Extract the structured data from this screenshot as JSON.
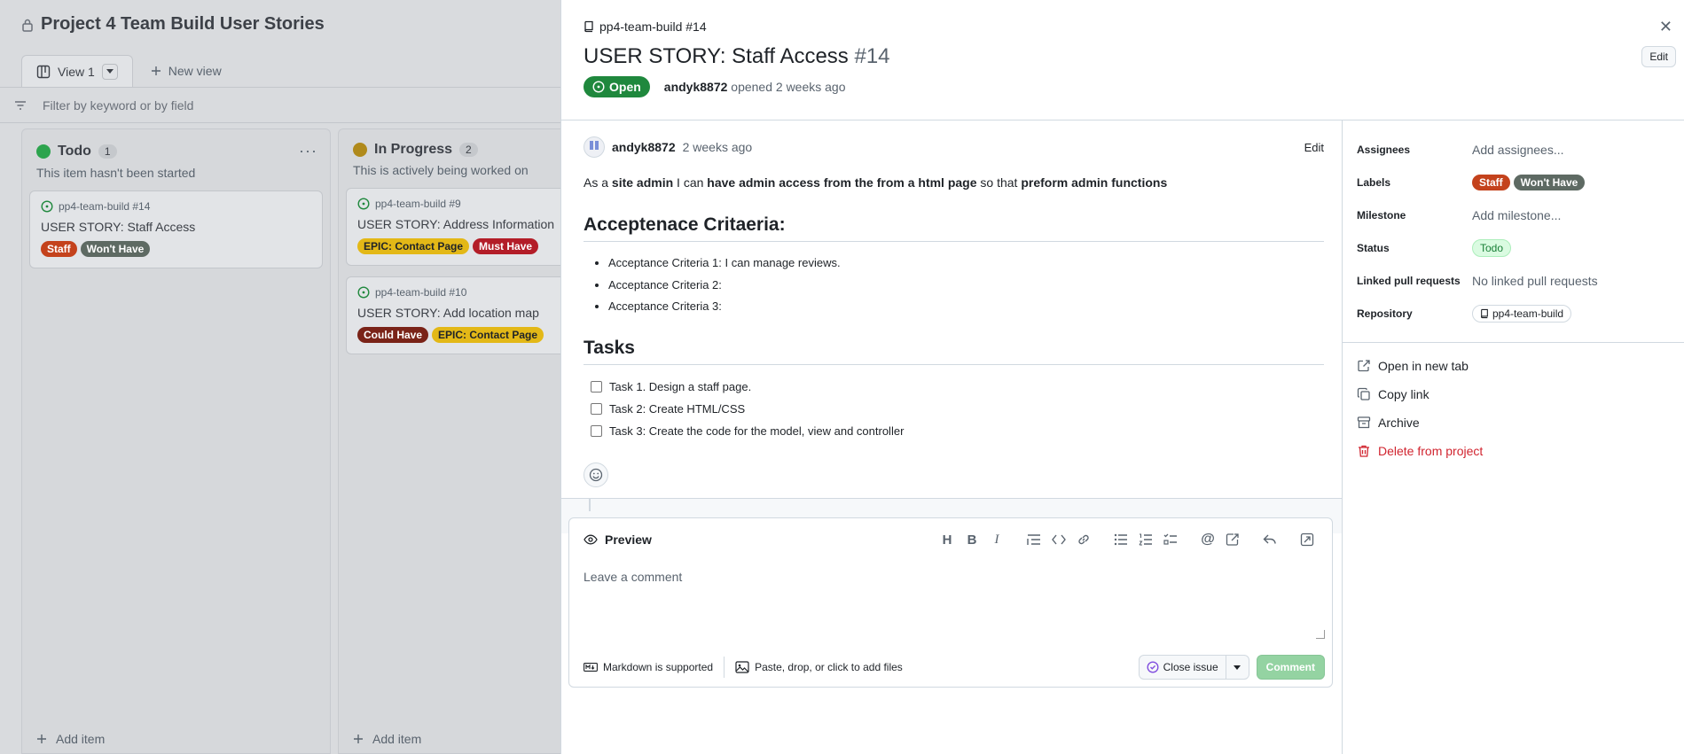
{
  "board": {
    "title": "Project 4 Team Build User Stories",
    "view_tab": "View 1",
    "new_view": "New view",
    "filter_placeholder": "Filter by keyword or by field",
    "add_item": "Add item",
    "columns": [
      {
        "name": "Todo",
        "count": "1",
        "color": "#2da44e",
        "description": "This item hasn't been started",
        "cards": [
          {
            "ref": "pp4-team-build #14",
            "title": "USER STORY: Staff Access",
            "labels": [
              {
                "text": "Staff",
                "bg": "#c4421c",
                "fg": "#ffffff"
              },
              {
                "text": "Won't Have",
                "bg": "#5e6a63",
                "fg": "#ffffff"
              }
            ]
          }
        ]
      },
      {
        "name": "In Progress",
        "count": "2",
        "color": "#b08a1b",
        "description": "This is actively being worked on",
        "cards": [
          {
            "ref": "pp4-team-build #9",
            "title": "USER STORY: Address Information",
            "labels": [
              {
                "text": "EPIC: Contact Page",
                "bg": "#e3b817",
                "fg": "#1f2328"
              },
              {
                "text": "Must Have",
                "bg": "#b31d28",
                "fg": "#ffffff"
              }
            ]
          },
          {
            "ref": "pp4-team-build #10",
            "title": "USER STORY: Add location map",
            "labels": [
              {
                "text": "Could Have",
                "bg": "#7a2318",
                "fg": "#ffffff"
              },
              {
                "text": "EPIC: Contact Page",
                "bg": "#e3b817",
                "fg": "#1f2328"
              }
            ]
          }
        ]
      }
    ]
  },
  "panel": {
    "repo_ref": "pp4-team-build #14",
    "title": "USER STORY: Staff Access",
    "number": "#14",
    "state": "Open",
    "author": "andyk8872",
    "opened_text": "opened 2 weeks ago",
    "edit_label": "Edit",
    "comment": {
      "author": "andyk8872",
      "time": "2 weeks ago",
      "edit": "Edit",
      "story": {
        "p1": "As a ",
        "b1": "site admin",
        "p2": " I can ",
        "b2": "have admin access from the from a html page",
        "p3": " so that ",
        "b3": "preform admin functions"
      },
      "criteria_heading": "Acceptenace Critaeria:",
      "criteria": [
        "Acceptance Criteria 1: I can manage reviews.",
        "Acceptance Criteria 2:",
        "Acceptance Criteria 3:"
      ],
      "tasks_heading": "Tasks",
      "tasks": [
        "Task 1. Design a staff page.",
        "Task 2: Create HTML/CSS",
        "Task 3: Create the code for the model, view and controller"
      ]
    },
    "editor": {
      "preview": "Preview",
      "placeholder": "Leave a comment",
      "markdown": "Markdown is supported",
      "files": "Paste, drop, or click to add files",
      "close_issue": "Close issue",
      "comment_btn": "Comment"
    },
    "fields": {
      "assignees_label": "Assignees",
      "assignees_value": "Add assignees...",
      "labels_label": "Labels",
      "labels": [
        {
          "text": "Staff",
          "bg": "#c4421c",
          "fg": "#ffffff"
        },
        {
          "text": "Won't Have",
          "bg": "#5e6a63",
          "fg": "#ffffff"
        }
      ],
      "milestone_label": "Milestone",
      "milestone_value": "Add milestone...",
      "status_label": "Status",
      "status_value": "Todo",
      "linked_label": "Linked pull requests",
      "linked_value": "No linked pull requests",
      "repo_label": "Repository",
      "repo_value": "pp4-team-build"
    },
    "actions": {
      "open_tab": "Open in new tab",
      "copy_link": "Copy link",
      "archive": "Archive",
      "delete": "Delete from project"
    }
  }
}
